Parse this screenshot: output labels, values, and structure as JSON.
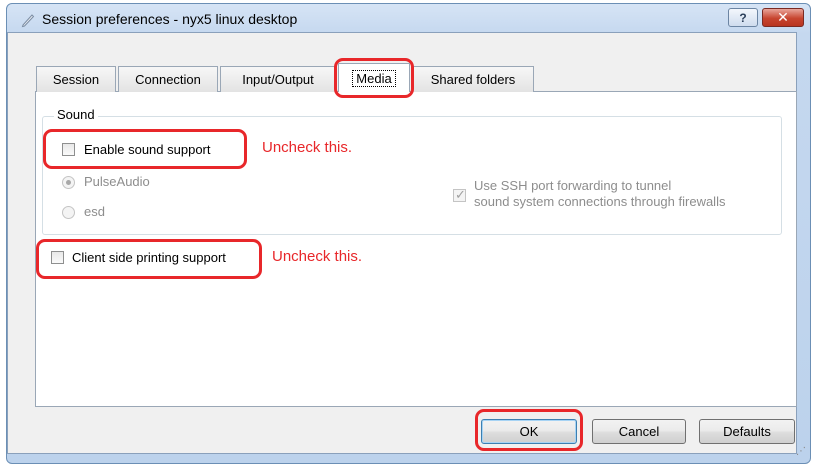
{
  "window": {
    "title": "Session preferences - nyx5 linux desktop",
    "help_label": "?",
    "close_label": "✕"
  },
  "tabs": [
    {
      "label": "Session"
    },
    {
      "label": "Connection"
    },
    {
      "label": "Input/Output"
    },
    {
      "label": "Media",
      "active": true
    },
    {
      "label": "Shared folders"
    }
  ],
  "sound_group": {
    "legend": "Sound",
    "enable_sound_label": "Enable sound support",
    "pulseaudio_label": "PulseAudio",
    "esd_label": "esd",
    "ssh_forward_line1": "Use SSH port forwarding to tunnel",
    "ssh_forward_line2": "sound system connections through firewalls"
  },
  "printing": {
    "label": "Client side printing support"
  },
  "annotations": {
    "sound_note": "Uncheck this.",
    "printing_note": "Uncheck this."
  },
  "buttons": {
    "ok": "OK",
    "cancel": "Cancel",
    "defaults": "Defaults"
  },
  "colors": {
    "annotation": "#e8272a",
    "close_button": "#c7452f"
  }
}
